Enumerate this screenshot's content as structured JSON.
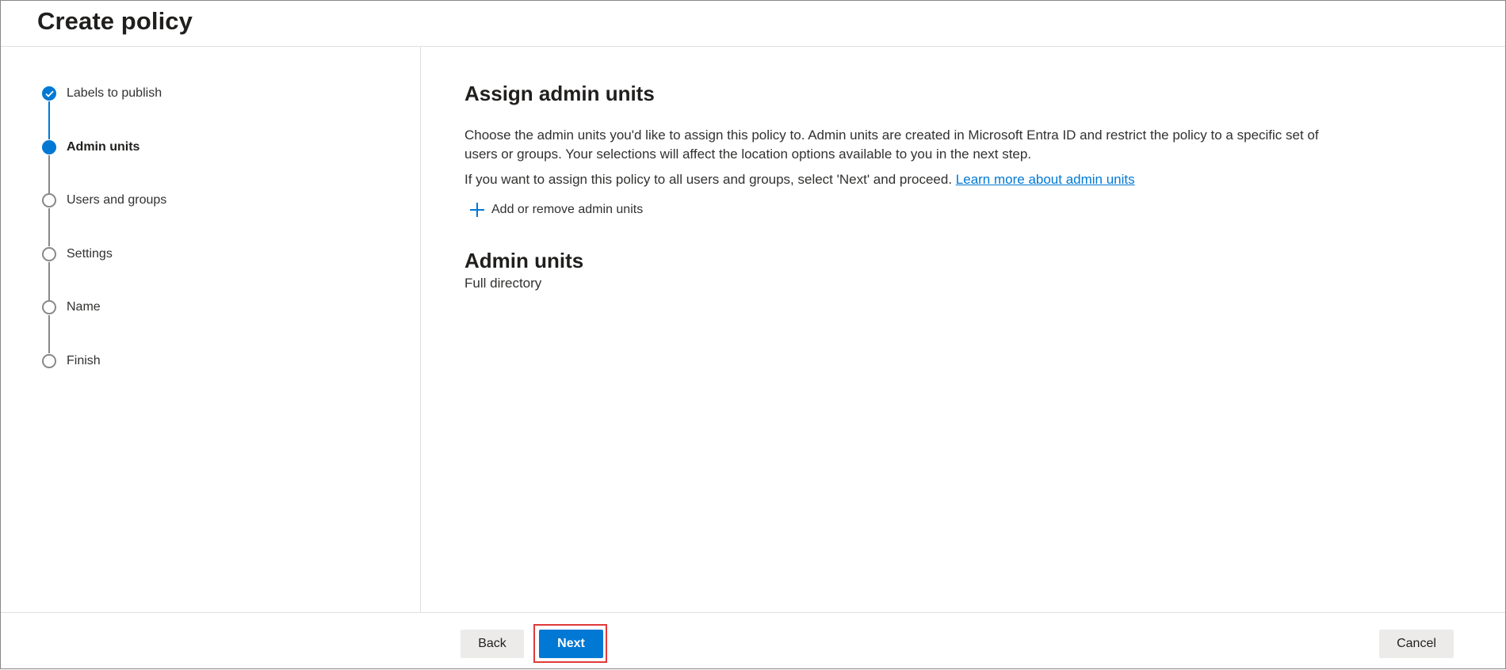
{
  "header": {
    "title": "Create policy"
  },
  "steps": [
    {
      "label": "Labels to publish",
      "state": "done"
    },
    {
      "label": "Admin units",
      "state": "current"
    },
    {
      "label": "Users and groups",
      "state": "pending"
    },
    {
      "label": "Settings",
      "state": "pending"
    },
    {
      "label": "Name",
      "state": "pending"
    },
    {
      "label": "Finish",
      "state": "pending"
    }
  ],
  "main": {
    "heading": "Assign admin units",
    "description": "Choose the admin units you'd like to assign this policy to. Admin units are created in Microsoft Entra ID and restrict the policy to a specific set of users or groups. Your selections will affect the location options available to you in the next step.",
    "all_users_text": "If you want to assign this policy to all users and groups, select 'Next' and proceed.",
    "learn_more_link": "Learn more about admin units",
    "add_button_label": "Add or remove admin units",
    "admin_units_heading": "Admin units",
    "admin_units_value": "Full directory"
  },
  "footer": {
    "back_label": "Back",
    "next_label": "Next",
    "cancel_label": "Cancel"
  },
  "colors": {
    "accent": "#0078d4",
    "highlight_border": "#e03a3a",
    "secondary_button": "#edebe9"
  }
}
